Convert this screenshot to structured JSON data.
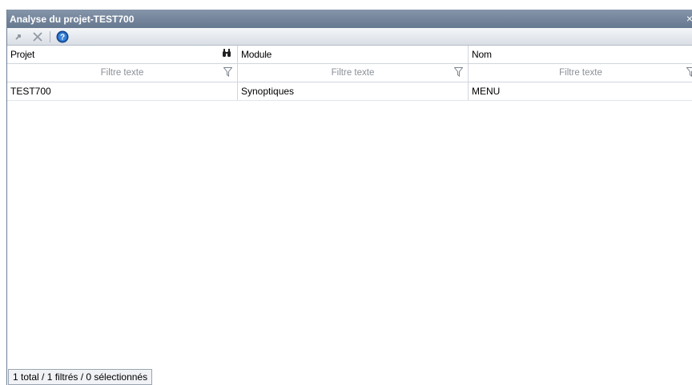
{
  "window": {
    "title": "Analyse du projet-TEST700",
    "close_glyph": "×"
  },
  "toolbar": {
    "buttons": [
      {
        "icon": "goto-arrow-icon"
      },
      {
        "icon": "delete-x-icon"
      },
      {
        "icon": "help-icon"
      }
    ]
  },
  "grid": {
    "columns": [
      {
        "label": "Projet",
        "filter_placeholder": "Filtre texte"
      },
      {
        "label": "Module",
        "filter_placeholder": "Filtre texte"
      },
      {
        "label": "Nom",
        "filter_placeholder": "Filtre texte"
      }
    ],
    "rows": [
      [
        "TEST700",
        "Synoptiques",
        "MENU"
      ]
    ]
  },
  "status": {
    "text": "1 total / 1 filtrés / 0 sélectionnés"
  },
  "colors": {
    "titlebar": "#7384a0",
    "accent": "#1a5fb4"
  }
}
